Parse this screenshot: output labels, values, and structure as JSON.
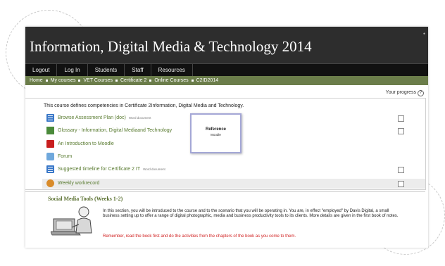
{
  "site": {
    "title": "Information, Digital Media & Technology 2014",
    "header_dot": "•"
  },
  "nav": {
    "items": [
      "Logout",
      "Log In",
      "Students",
      "Staff",
      "Resources"
    ]
  },
  "breadcrumb": [
    "Home",
    "My courses",
    "VET Courses",
    "Certificate 2",
    "Online Courses",
    "C2ID2014"
  ],
  "progress": {
    "label": "Your progress",
    "help_icon": "?"
  },
  "section1": {
    "summary": "This course defines competencies in Certificate 2Information, Digital Media and Technology.",
    "items": [
      {
        "label": "Browse Assessment Plan (doc)",
        "desc": "Word document",
        "icon": "document-icon"
      },
      {
        "label": "Glossary - Information, Digital Mediaand Technology",
        "desc": "",
        "icon": "glossary-icon"
      },
      {
        "label": "An Introduction to Moodle",
        "desc": "",
        "icon": "pdf-icon"
      },
      {
        "label": "Forum",
        "desc": "",
        "icon": "forum-icon"
      },
      {
        "label": "Suggested timeline for Certificate 2 IT",
        "desc": "Word document",
        "icon": "document-icon"
      },
      {
        "label": "Weekly workrecord",
        "desc": "",
        "icon": "workrecord-icon"
      }
    ],
    "popup": {
      "title": "Reference",
      "subtitle": "Moodle"
    }
  },
  "section2": {
    "title": "Social Media Tools (Weeks 1-2)",
    "text": "In this section, you will be introduced to the course and to the scenario that you will be operating in. You are, in effect \"employed\" by Davis Digital, a small business setting up to offer a range of digital photographic, media and business productivity tools to its clients. More details are given in the first book of notes.",
    "warning": "Remember, read the book first and do the activities from the chapters of the book as you come to them."
  },
  "colors": {
    "header_bg": "#2d2d2d",
    "nav_bg": "#111111",
    "breadcrumb_bg": "#6b7d4a",
    "link_green": "#587a2f",
    "warning_red": "#d01f1f"
  }
}
